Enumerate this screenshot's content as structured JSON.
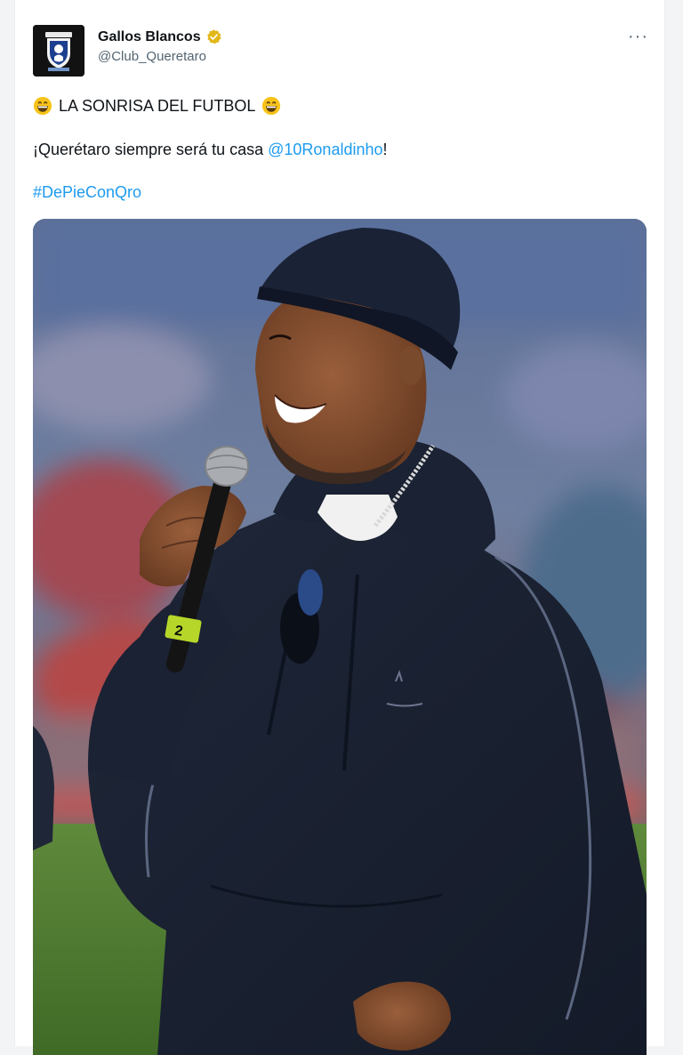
{
  "tweet": {
    "author_name": "Gallos Blancos",
    "author_handle": "@Club_Queretaro",
    "verified_badge": "gold-verified-icon",
    "more_label": "···",
    "line1_text": "LA SONRISA DEL FUTBOL",
    "line1_emoji": "grinning-face-icon",
    "line2_prefix": "¡Querétaro siempre será tu casa",
    "line2_mention": "@10Ronaldinho",
    "line2_suffix": "!",
    "hashtag": "#DePieConQro"
  },
  "media": {
    "type": "photo",
    "mic_tag_number": "2"
  },
  "colors": {
    "link": "#1d9bf0",
    "verified": "#e2b719",
    "text": "#0f1419",
    "secondary": "#536471"
  }
}
